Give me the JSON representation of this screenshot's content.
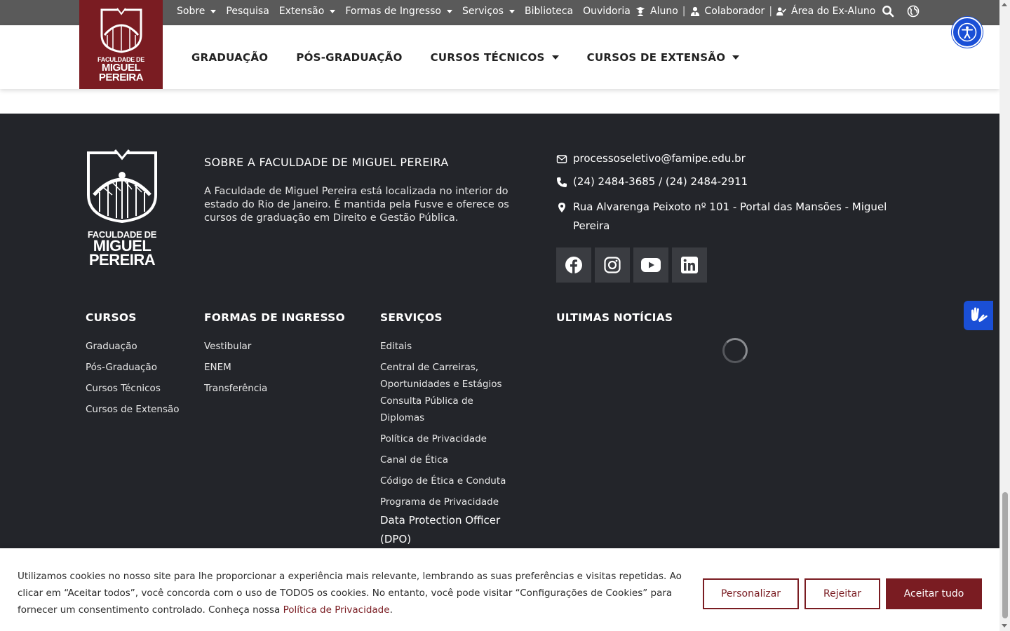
{
  "topbar": {
    "nav": [
      {
        "label": "Sobre",
        "dropdown": true
      },
      {
        "label": "Pesquisa",
        "dropdown": false
      },
      {
        "label": "Extensão",
        "dropdown": true
      },
      {
        "label": "Formas de Ingresso",
        "dropdown": true
      },
      {
        "label": "Serviços",
        "dropdown": true
      },
      {
        "label": "Biblioteca",
        "dropdown": false
      },
      {
        "label": "Ouvidoria",
        "dropdown": false
      }
    ],
    "users": [
      {
        "label": "Aluno",
        "icon": "graduate-icon"
      },
      {
        "label": "Colaborador",
        "icon": "user-tie-icon"
      },
      {
        "label": "Área do Ex-Aluno",
        "icon": "user-check-icon"
      }
    ],
    "separator": "|"
  },
  "logo": {
    "line1": "FACULDADE DE",
    "line2": "MIGUEL",
    "line3": "PEREIRA"
  },
  "mainnav": [
    {
      "label": "GRADUAÇÃO",
      "dropdown": false
    },
    {
      "label": "PÓS-GRADUAÇÃO",
      "dropdown": false
    },
    {
      "label": "CURSOS TÉCNICOS",
      "dropdown": true
    },
    {
      "label": "CURSOS DE EXTENSÃO",
      "dropdown": true
    }
  ],
  "footer": {
    "about": {
      "title": "SOBRE A FACULDADE DE MIGUEL PEREIRA",
      "text": "A Faculdade de Miguel Pereira está localizada no interior do estado do Rio de Janeiro. É mantida pela Fusve e oferece os cursos de graduação em Direito e Gestão Pública."
    },
    "contact": {
      "email": "processoseletivo@famipe.edu.br",
      "phone": "(24) 2484-3685 / (24) 2484-2911",
      "address": "Rua Alvarenga Peixoto nº 101 - Portal das Mansões - Miguel Pereira"
    },
    "socials": [
      "facebook-icon",
      "instagram-icon",
      "youtube-icon",
      "linkedin-icon"
    ],
    "columns": {
      "cursos": {
        "title": "CURSOS",
        "items": [
          "Graduação",
          "Pós-Graduação",
          "Cursos Técnicos",
          "Cursos de Extensão"
        ]
      },
      "ingresso": {
        "title": "FORMAS DE INGRESSO",
        "items": [
          "Vestibular",
          "ENEM",
          "Transferência"
        ]
      },
      "servicos": {
        "title": "SERVIÇOS",
        "items": [
          "Editais",
          "Central de Carreiras, Oportunidades e Estágios",
          "Consulta Pública de Diplomas",
          "Política de Privacidade",
          "Canal de Ética",
          "Código de Ética e Conduta",
          "Programa de Privacidade"
        ]
      },
      "noticias": {
        "title": "ULTIMAS NOTÍCIAS"
      }
    },
    "dpo": "Data Protection Officer (DPO)"
  },
  "cookie": {
    "text": "Utilizamos cookies no nosso site para lhe proporcionar a experiência mais relevante, lembrando as suas preferências e visitas repetidas. Ao clicar em “Aceitar todos”, você concorda com o uso de TODOS os cookies. No entanto, você pode visitar “Configurações de Cookies” para fornecer um consentimento controlado. Conheça nossa ",
    "link": "Política de Privacidade",
    "after_link": ".",
    "buttons": {
      "customize": "Personalizar",
      "reject": "Rejeitar",
      "accept": "Aceitar tudo"
    }
  },
  "colors": {
    "brand": "#7a1c22",
    "footer_bg": "#23252a",
    "topbar_bg": "#5a5a5a",
    "accessibility": "#1a4fd6"
  }
}
